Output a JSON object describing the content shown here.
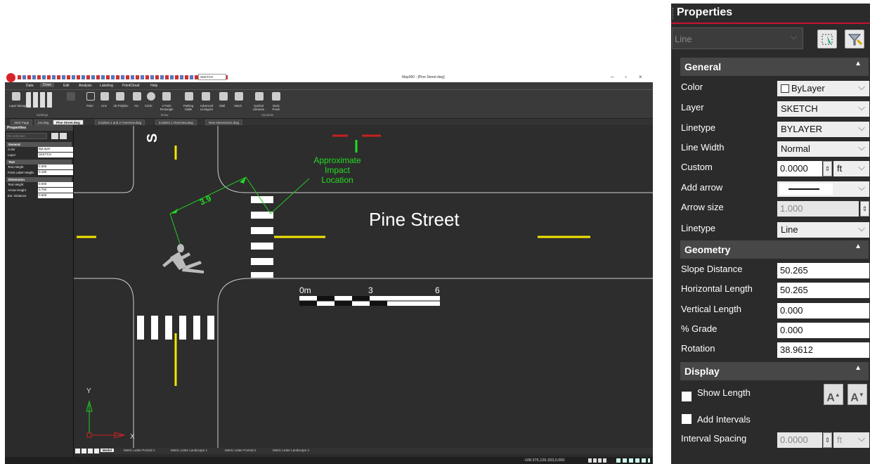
{
  "app": {
    "title": "Map360 - [Pine Street.dwg]",
    "layer_dropdown": "SKETCH",
    "menus": [
      "Data",
      "Draw",
      "Edit",
      "Analysis",
      "Labeling",
      "PointCloud",
      "Help"
    ],
    "active_menu": "Draw",
    "ribbon": {
      "buttons": [
        "Layer Manager",
        "Point",
        "Line",
        "2D Polyline",
        "Arc",
        "Circle",
        "2 Point Rectangle",
        "Parking Stalls",
        "Advanced Linetypes",
        "Wall",
        "Hatch",
        "Symbol Librarian",
        "Body Poser"
      ],
      "groups": [
        "Settings",
        "Draw",
        "Symbols"
      ]
    },
    "doc_tabs": [
      "Start Page",
      "ext.dwg",
      "Pine Street.dwg",
      "Incident 1 and 2 Overview.dwg",
      "Incident 1 Overview.dwg",
      "New Intersection.dwg"
    ],
    "active_doc_tab": "Pine Street.dwg",
    "left_panel": {
      "title": "Properties",
      "selection": "No selection",
      "sections": [
        {
          "title": "General",
          "rows": [
            {
              "label": "Color",
              "value": "ByLayer"
            },
            {
              "label": "Layer",
              "value": "SKETCH"
            }
          ]
        },
        {
          "title": "Text",
          "rows": [
            {
              "label": "Text Height",
              "value": "0.300"
            },
            {
              "label": "Point Label Height",
              "value": "0.180"
            }
          ]
        },
        {
          "title": "Dimension",
          "rows": [
            {
              "label": "Text Height",
              "value": "0.000"
            },
            {
              "label": "Arrow Height",
              "value": "0.750"
            },
            {
              "label": "Ext. Distance",
              "value": "0.500"
            }
          ]
        }
      ]
    },
    "canvas": {
      "street_name": "Pine Street",
      "impact_label": [
        "Approximate",
        "Impact",
        "Location"
      ],
      "dimension": "3.9",
      "cross_street_letter": "S",
      "scale": {
        "labels": [
          "0m",
          "3",
          "6"
        ]
      },
      "axis_x": "X",
      "axis_y": "Y"
    },
    "layout_tabs": [
      "Model",
      "Metric Letter Portrait 1",
      "Metric Letter Landscape 1",
      "Metric Letter Portrait 2",
      "Metric Letter Landscape 2"
    ],
    "active_layout_tab": "Model",
    "coordinates": "-108.376,126.333,0.000"
  },
  "properties": {
    "title": "Properties",
    "selection": "Line",
    "general": {
      "title": "General",
      "rows": [
        {
          "label": "Color",
          "value": "ByLayer"
        },
        {
          "label": "Layer",
          "value": "SKETCH"
        },
        {
          "label": "Linetype",
          "value": "BYLAYER"
        },
        {
          "label": "Line Width",
          "value": "Normal"
        },
        {
          "label": "Custom",
          "value": "0.0000",
          "unit": "ft"
        },
        {
          "label": "Add arrow",
          "value": ""
        },
        {
          "label": "Arrow size",
          "value": "1.000"
        },
        {
          "label": "Linetype",
          "value": "Line"
        }
      ]
    },
    "geometry": {
      "title": "Geometry",
      "rows": [
        {
          "label": "Slope Distance",
          "value": "50.265"
        },
        {
          "label": "Horizontal Length",
          "value": "50.265"
        },
        {
          "label": "Vertical Length",
          "value": "0.000"
        },
        {
          "label": "% Grade",
          "value": "0.000"
        },
        {
          "label": "Rotation",
          "value": "38.9612"
        }
      ]
    },
    "display": {
      "title": "Display",
      "show_length": "Show Length",
      "add_intervals": "Add Intervals",
      "interval_spacing_label": "Interval Spacing",
      "interval_spacing_value": "0.0000",
      "interval_unit": "ft"
    }
  },
  "colors": {
    "accent_red": "#c8102e",
    "road_yellow": "#f4e600",
    "annotation_green": "#22dd22"
  }
}
